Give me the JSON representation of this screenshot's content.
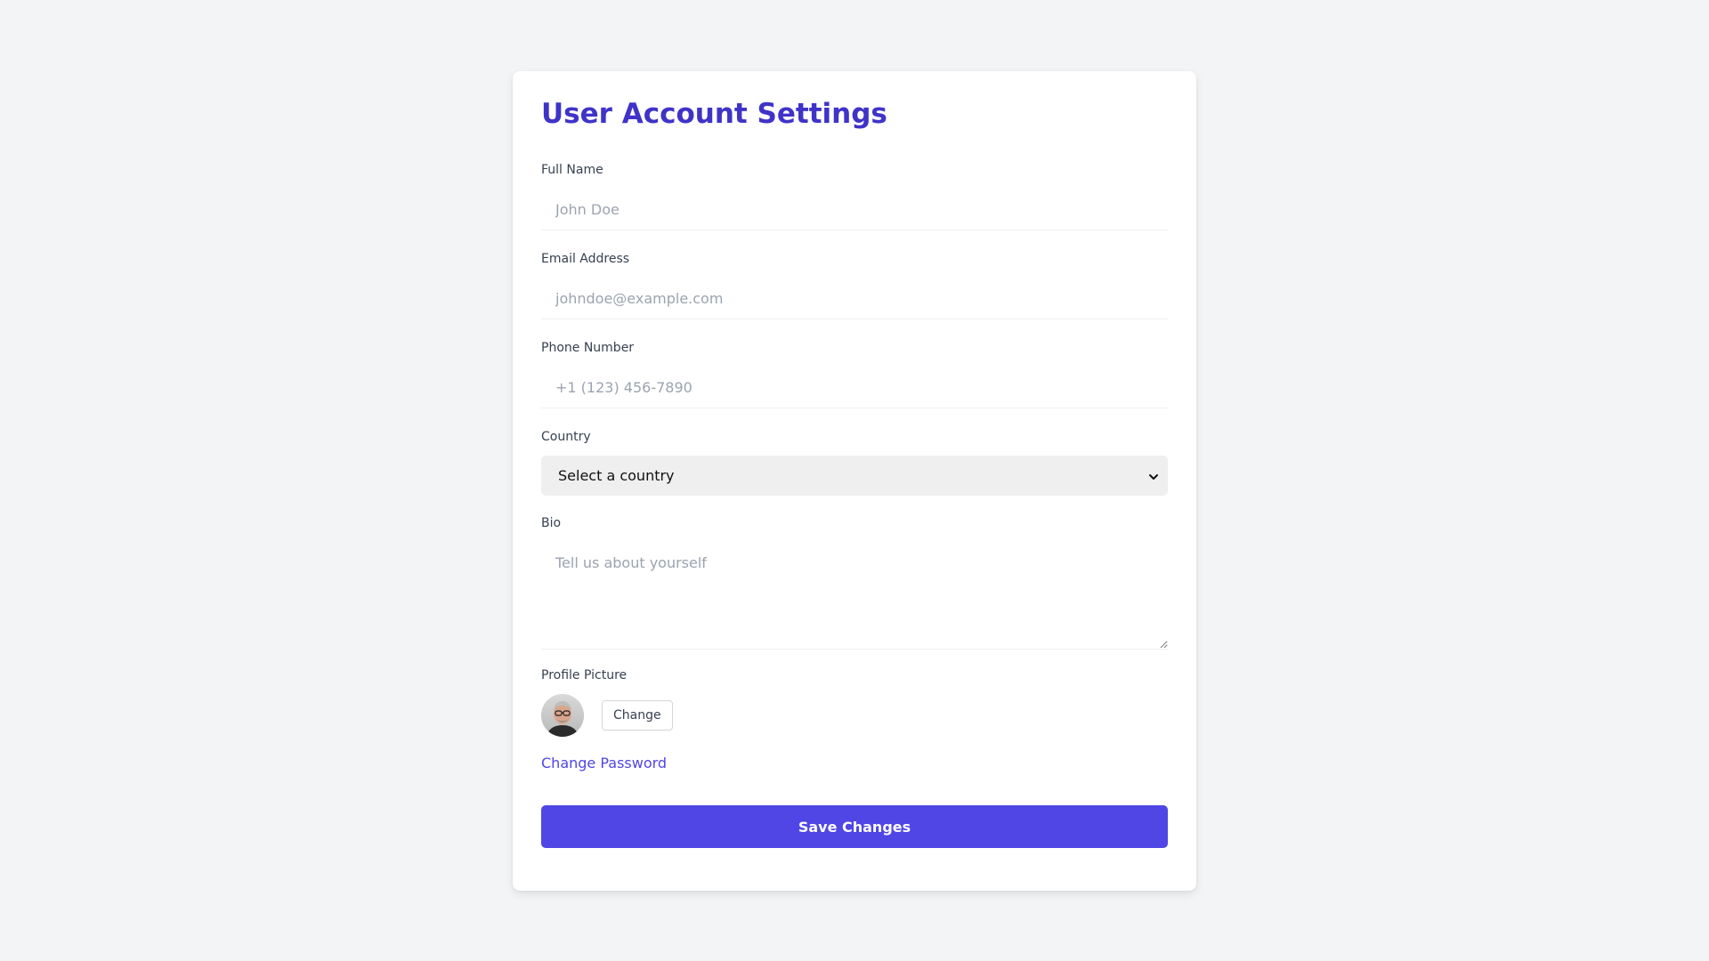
{
  "page": {
    "title": "User Account Settings"
  },
  "form": {
    "full_name": {
      "label": "Full Name",
      "value": "",
      "placeholder": "John Doe"
    },
    "email": {
      "label": "Email Address",
      "value": "",
      "placeholder": "johndoe@example.com"
    },
    "phone": {
      "label": "Phone Number",
      "value": "",
      "placeholder": "+1 (123) 456-7890"
    },
    "country": {
      "label": "Country",
      "selected": "Select a country"
    },
    "bio": {
      "label": "Bio",
      "value": "",
      "placeholder": "Tell us about yourself"
    },
    "profile_picture": {
      "label": "Profile Picture",
      "change_label": "Change"
    },
    "change_password_label": "Change Password",
    "save_label": "Save Changes"
  },
  "colors": {
    "accent": "#4f46e5",
    "title": "#3f33c8",
    "background": "#f3f4f6",
    "card": "#ffffff"
  },
  "icons": {
    "select_chevron": "chevron-down-icon",
    "avatar": "avatar-photo"
  }
}
